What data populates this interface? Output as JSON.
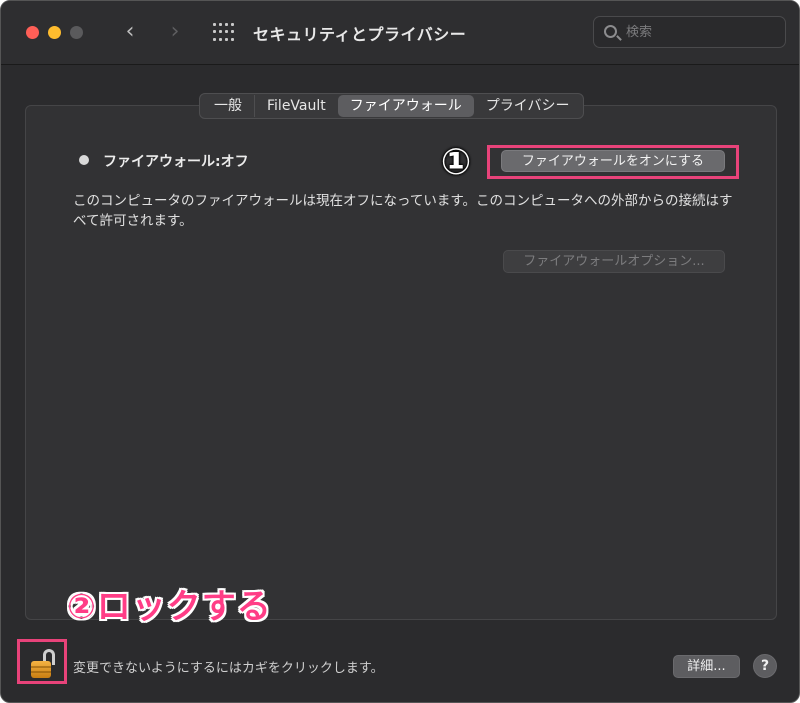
{
  "window": {
    "title": "セキュリティとプライバシー"
  },
  "toolbar": {
    "back_icon": "chevron-left-icon",
    "forward_icon": "chevron-right-icon",
    "grid_icon": "show-all-grid-icon",
    "search": {
      "value": "",
      "placeholder": "検索",
      "icon": "search-icon"
    }
  },
  "tabs": [
    {
      "label": "一般",
      "active": false
    },
    {
      "label": "FileVault",
      "active": false
    },
    {
      "label": "ファイアウォール",
      "active": true
    },
    {
      "label": "プライバシー",
      "active": false
    }
  ],
  "firewall": {
    "status_label": "ファイアウォール:オフ",
    "turn_on_button": "ファイアウォールをオンにする",
    "description": "このコンピュータのファイアウォールは現在オフになっています。このコンピュータへの外部からの接続はすべて許可されます。",
    "options_button": "ファイアウォールオプション..."
  },
  "annotations": {
    "step1": "①",
    "step2": "②ロックする",
    "highlight_color": "#e8437a",
    "step2_color": "#ff3d86"
  },
  "footer": {
    "lock_icon": "unlocked-padlock-icon",
    "lock_text": "変更できないようにするにはカギをクリックします。",
    "details_button": "詳細...",
    "help_button": "?"
  },
  "colors": {
    "traffic_close": "#fe5f57",
    "traffic_minimize": "#febc2e",
    "window_bg": "#2b2b2d"
  }
}
